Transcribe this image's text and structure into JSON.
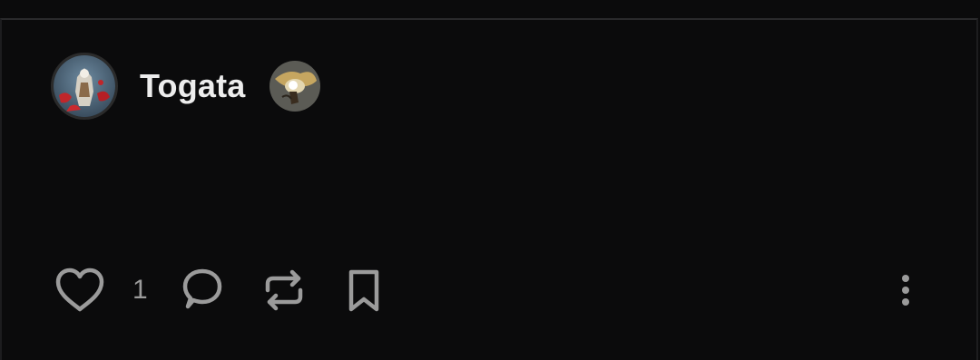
{
  "post": {
    "username": "Togata",
    "likes": "1"
  },
  "icons": {
    "like": "heart-icon",
    "reply": "speech-bubble-icon",
    "repost": "repost-arrows-icon",
    "bookmark": "bookmark-icon",
    "more": "vertical-ellipsis-icon"
  },
  "colors": {
    "background": "#0b0b0c",
    "username": "#ededed",
    "icon": "#9b9b9b"
  }
}
